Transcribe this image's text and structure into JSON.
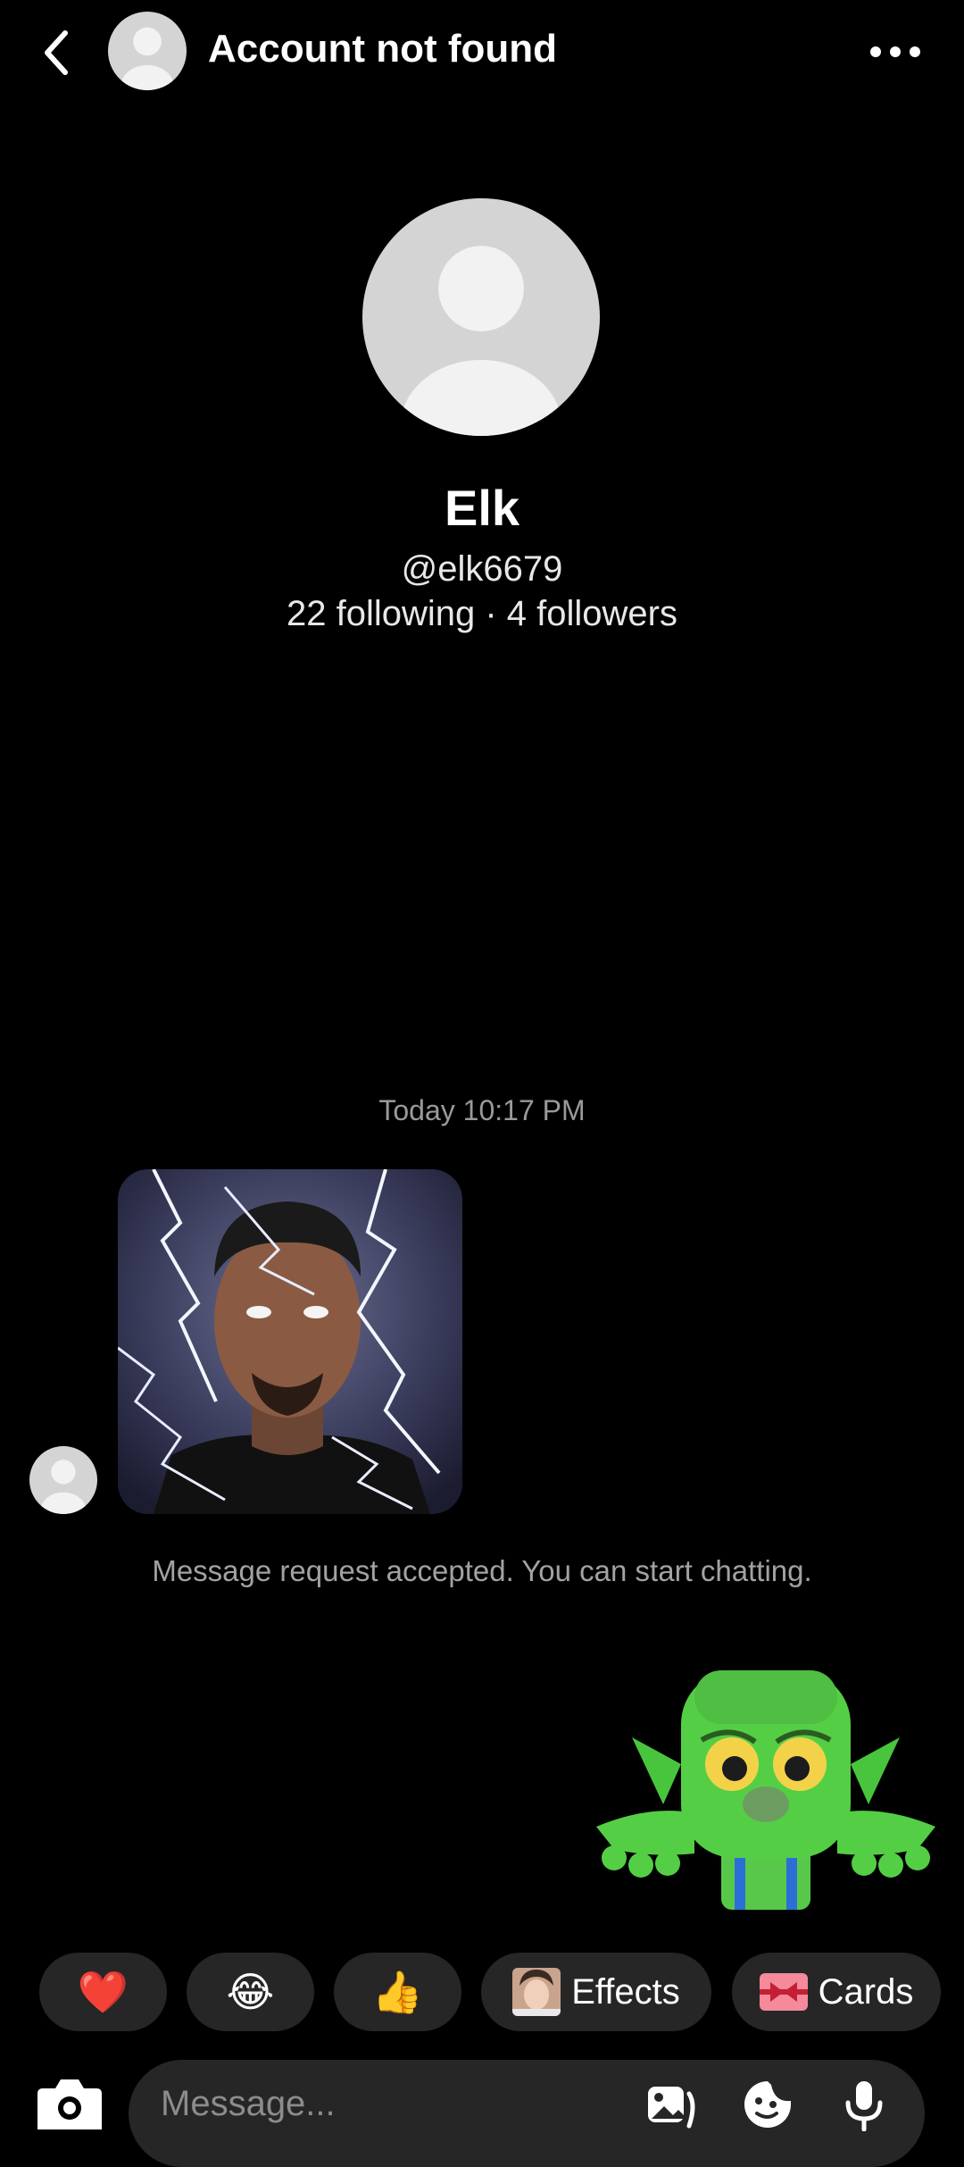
{
  "header": {
    "title": "Account not found"
  },
  "profile": {
    "name": "Elk",
    "handle": "@elk6679",
    "stats": "22 following · 4 followers"
  },
  "chat": {
    "timestamp": "Today 10:17 PM",
    "system_note": "Message request accepted. You can start chatting."
  },
  "quick_reactions": {
    "heart": "❤️",
    "laugh": "😂",
    "thumbs_up": "👍",
    "effects_label": "Effects",
    "cards_label": "Cards"
  },
  "composer": {
    "placeholder": "Message..."
  },
  "colors": {
    "background": "#000000",
    "chip_background": "#262626",
    "avatar_placeholder": "#d4d4d4"
  }
}
